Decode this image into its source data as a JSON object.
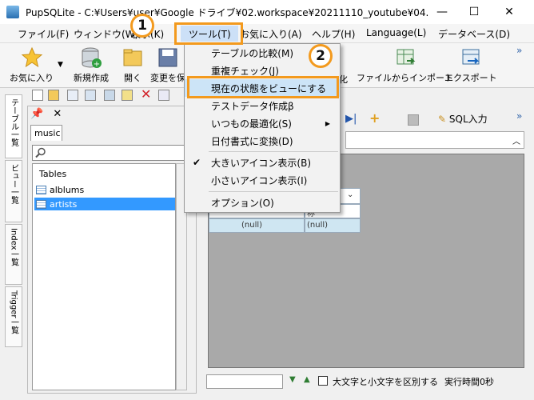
{
  "window": {
    "title": "PupSQLite - C:¥Users¥user¥Google ドライブ¥02.workspace¥20211110_youtube¥04....",
    "minimize": "—",
    "maximize": "☐",
    "close": "✕"
  },
  "menubar": {
    "items": [
      "ファイル(F)",
      "ウィンドウ(W)",
      "表示(K)",
      "ツール(T)",
      "お気に入り(A)",
      "ヘルプ(H)",
      "Language(L)",
      "データベース(D)"
    ]
  },
  "toolbar": {
    "favorites": "お気に入り",
    "new": "新規作成",
    "open": "開く",
    "save_changes": "変更を保",
    "hidden_suffix": "化",
    "import_file": "ファイルからインポート",
    "export": "エクスポート",
    "more": "»"
  },
  "left_panel": {
    "db_tab": "music",
    "tree_header": "Tables",
    "tables": [
      "alblums",
      "artists"
    ],
    "selected_index": 1,
    "vertical_tabs": [
      "テーブル一覧",
      "ビュー一覧",
      "Index一覧",
      "Trigger一覧"
    ]
  },
  "right_panel": {
    "sql_button": "SQL入力",
    "grid_header_fragment": "称",
    "grid_cell_1": "(null)",
    "grid_cell_2": "(null)",
    "case_label": "大文字と小文字を区別する",
    "exec_time": "実行時間0秒"
  },
  "tools_menu": {
    "items": [
      {
        "label": "テーブルの比較(M)"
      },
      {
        "label": "重複チェック(J)"
      },
      {
        "label": "現在の状態をビューにする"
      },
      {
        "label": "テストデータ作成β"
      },
      {
        "label": "いつもの最適化(S)",
        "submenu": true
      },
      {
        "label": "日付書式に変換(D)"
      },
      {
        "label": "大きいアイコン表示(B)",
        "checked": true
      },
      {
        "label": "小さいアイコン表示(I)"
      },
      {
        "label": "オプション(O)"
      }
    ],
    "check_mark": "✔",
    "submenu_arrow": "▶"
  },
  "annotations": {
    "step1": "1",
    "step2": "2",
    "highlight_color": "#f39a1e"
  }
}
